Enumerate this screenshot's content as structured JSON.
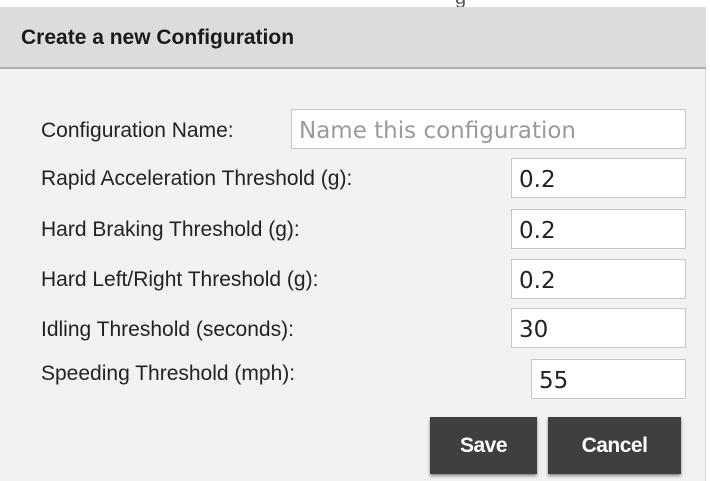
{
  "background_fragment": "g",
  "dialog": {
    "title": "Create a new Configuration"
  },
  "form": {
    "fields": [
      {
        "label": "Configuration Name:",
        "value": "",
        "placeholder": "Name this configuration"
      },
      {
        "label": "Rapid Acceleration Threshold (g):",
        "value": "0.2",
        "placeholder": ""
      },
      {
        "label": "Hard Braking Threshold (g):",
        "value": "0.2",
        "placeholder": ""
      },
      {
        "label": "Hard Left/Right Threshold (g):",
        "value": "0.2",
        "placeholder": ""
      },
      {
        "label": "Idling Threshold (seconds):",
        "value": "30",
        "placeholder": ""
      },
      {
        "label": "Speeding Threshold (mph):",
        "value": "55",
        "placeholder": ""
      }
    ]
  },
  "buttons": {
    "save_label": "Save",
    "cancel_label": "Cancel"
  },
  "colors": {
    "header_bg": "#dcdcdc",
    "dialog_bg": "#f2f2f2",
    "button_bg": "#3f3f3f",
    "button_text": "#ffffff"
  }
}
